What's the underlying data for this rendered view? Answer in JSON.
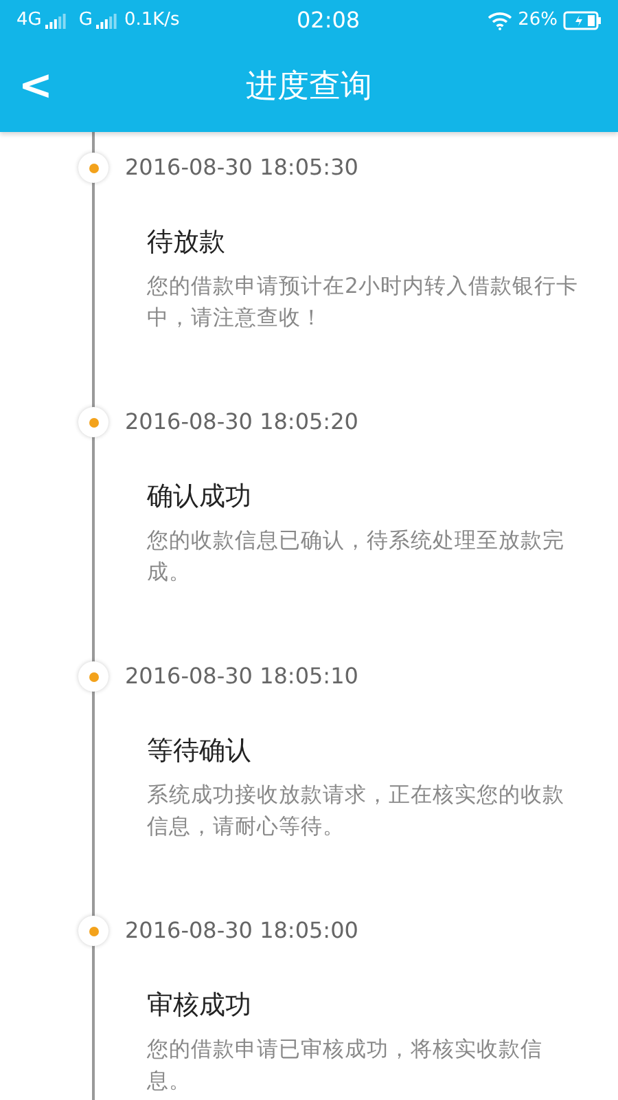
{
  "status_bar": {
    "network_1": "4G",
    "network_2": "G",
    "speed": "0.1K/s",
    "time": "02:08",
    "battery": "26%"
  },
  "header": {
    "back": "<",
    "title": "进度查询"
  },
  "timeline": [
    {
      "time": "2016-08-30 18:05:30",
      "title": "待放款",
      "description": "您的借款申请预计在2小时内转入借款银行卡中，请注意查收！"
    },
    {
      "time": "2016-08-30 18:05:20",
      "title": "确认成功",
      "description": "您的收款信息已确认，待系统处理至放款完成。"
    },
    {
      "time": "2016-08-30 18:05:10",
      "title": "等待确认",
      "description": "系统成功接收放款请求，正在核实您的收款信息，请耐心等待。"
    },
    {
      "time": "2016-08-30 18:05:00",
      "title": "审核成功",
      "description": "您的借款申请已审核成功，将核实收款信息。"
    }
  ]
}
